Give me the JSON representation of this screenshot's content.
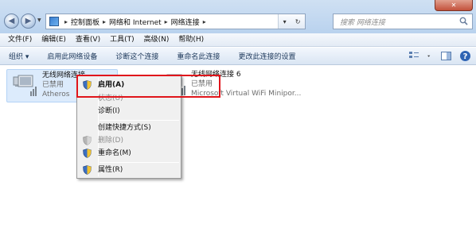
{
  "window": {
    "close_glyph": "✕"
  },
  "address": {
    "crumbs": [
      "控制面板",
      "网络和 Internet",
      "网络连接"
    ],
    "arrow": "▸",
    "refresh_glyph": "↻",
    "dropdown_glyph": "▾"
  },
  "search": {
    "placeholder": "搜索 网络连接"
  },
  "menubar": {
    "items": [
      "文件(F)",
      "编辑(E)",
      "查看(V)",
      "工具(T)",
      "高级(N)",
      "帮助(H)"
    ]
  },
  "commandbar": {
    "items": [
      "组织 ▾",
      "启用此网络设备",
      "诊断这个连接",
      "重命名此连接",
      "更改此连接的设置"
    ]
  },
  "connections": [
    {
      "name": "无线网络连接",
      "status": "已禁用",
      "device": "Atheros"
    },
    {
      "name": "无线网络连接 6",
      "status": "已禁用",
      "device": "Microsoft Virtual WiFi Minipor..."
    }
  ],
  "context_menu": {
    "items": [
      {
        "label": "启用(A)",
        "disabled": false,
        "bold": true,
        "shield": true
      },
      {
        "label": "状态(U)",
        "disabled": true,
        "bold": false,
        "shield": false
      },
      {
        "label": "诊断(I)",
        "disabled": false,
        "bold": false,
        "shield": false
      },
      {
        "label": "创建快捷方式(S)",
        "disabled": false,
        "bold": false,
        "shield": false
      },
      {
        "label": "删除(D)",
        "disabled": true,
        "bold": false,
        "shield": true
      },
      {
        "label": "重命名(M)",
        "disabled": false,
        "bold": false,
        "shield": true
      },
      {
        "label": "属性(R)",
        "disabled": false,
        "bold": false,
        "shield": true
      }
    ]
  },
  "colors": {
    "highlight": "#e0151b",
    "selection": "#dcebfc"
  }
}
